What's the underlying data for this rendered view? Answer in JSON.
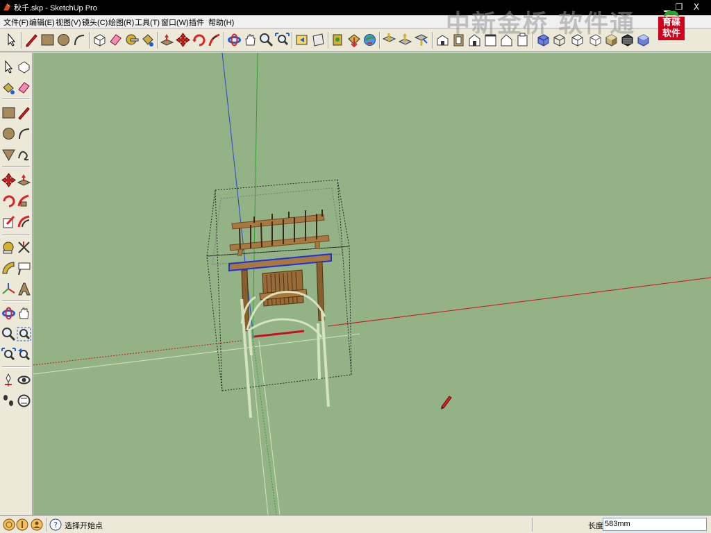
{
  "window": {
    "title": "秋千.skp - SketchUp Pro",
    "minimize_glyph": "▁",
    "restore_glyph": "❐",
    "close_glyph": "X"
  },
  "menu": [
    "文件(F)",
    "编辑(E)",
    "视图(V)",
    "镜头(C)",
    "绘图(R)",
    "工具(T)",
    "窗口(W)",
    "插件",
    "帮助(H)"
  ],
  "watermark": {
    "text": "中新金桥 软件通",
    "logo_text_line1": "育碟",
    "logo_text_line2": "软件"
  },
  "toolbar_icons": [
    "select-icon",
    "pencil-line-icon",
    "rectangle-icon",
    "circle-icon",
    "arc-icon",
    "make-component-icon",
    "eraser-icon",
    "tape-measure-icon",
    "paint-bucket-icon",
    "push-pull-icon",
    "move-icon",
    "rotate-icon",
    "follow-me-icon",
    "orbit-icon",
    "pan-icon",
    "zoom-icon",
    "zoom-extents-icon",
    "previous-view-icon",
    "next-view-icon",
    "place-model-icon",
    "get-models-icon",
    "share-model-icon",
    "google-earth-icon",
    "toggle-terrain-icon",
    "photo-texture-icon",
    "iso-view-icon",
    "top-view-icon",
    "front-view-icon",
    "right-view-icon",
    "back-view-icon",
    "left-view-icon",
    "xray-icon",
    "wireframe-icon",
    "hidden-line-icon",
    "shaded-icon",
    "shaded-texture-icon",
    "monochrome-icon"
  ],
  "left_tools": [
    "select-icon",
    "make-component-icon",
    "paint-bucket-icon",
    "eraser-icon",
    "rectangle-icon",
    "pencil-line-icon",
    "circle-icon",
    "arc-icon",
    "polygon-icon",
    "freehand-icon",
    "move-icon",
    "push-pull-icon",
    "rotate-icon",
    "follow-me-icon",
    "scale-icon",
    "offset-icon",
    "tape-measure-icon",
    "dimension-icon",
    "protractor-icon",
    "text-icon",
    "axes-icon",
    "3d-text-icon",
    "orbit-icon",
    "pan-icon",
    "zoom-icon",
    "zoom-window-icon",
    "zoom-extents-icon",
    "previous-view-icon",
    "position-camera-icon",
    "look-around-icon",
    "walk-icon",
    "section-plane-icon"
  ],
  "colors": {
    "viewport": "#93b387",
    "red_axis": "#c8101e",
    "green_axis": "#2fa12f",
    "blue_axis": "#2b3fd1",
    "wood": "#a9783e",
    "wood_dark": "#6b4a24",
    "selection_blue": "#1d2fe0",
    "chain": "#d6e3c0"
  },
  "status": {
    "hint": "选择开始点",
    "length_label": "长度",
    "length_value": "583mm"
  }
}
